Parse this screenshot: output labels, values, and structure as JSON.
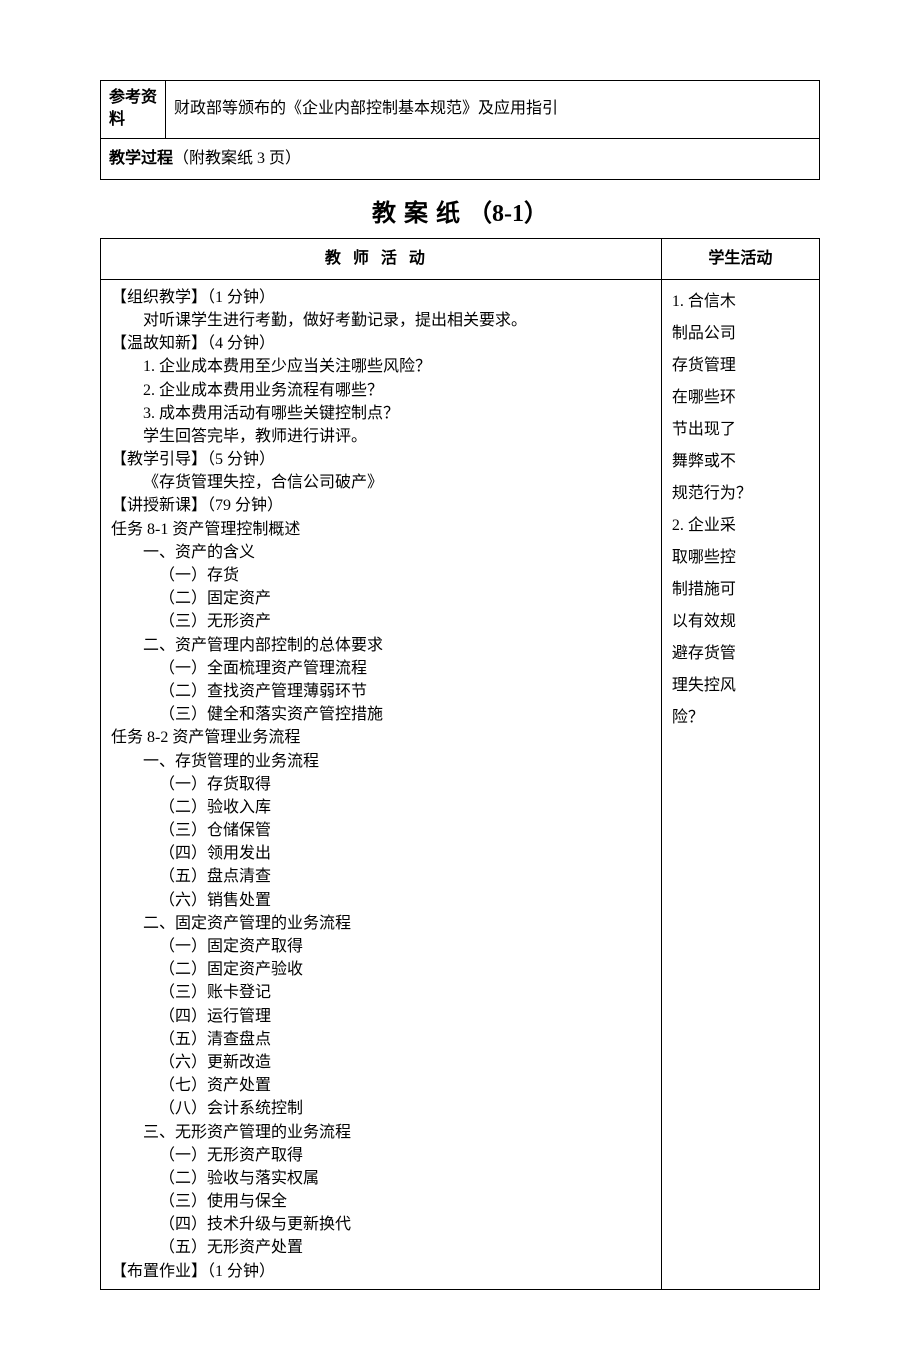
{
  "ref": {
    "label": "参考资料",
    "content": "财政部等颁布的《企业内部控制基本规范》及应用指引"
  },
  "process": {
    "label": "教学过程",
    "note": "（附教案纸 3 页）"
  },
  "title": {
    "main": "教案纸",
    "paren": "（8-1）"
  },
  "headers": {
    "teacher": "教师活动",
    "student": "学生活动"
  },
  "teacher_lines": [
    {
      "cls": "i1",
      "text": "【组织教学】（1 分钟）"
    },
    {
      "cls": "i2",
      "text": "对听课学生进行考勤，做好考勤记录，提出相关要求。"
    },
    {
      "cls": "i1",
      "text": "【温故知新】（4 分钟）"
    },
    {
      "cls": "i2",
      "text": "1. 企业成本费用至少应当关注哪些风险？"
    },
    {
      "cls": "i2",
      "text": "2. 企业成本费用业务流程有哪些？"
    },
    {
      "cls": "i2",
      "text": "3. 成本费用活动有哪些关键控制点？"
    },
    {
      "cls": "i2",
      "text": "学生回答完毕，教师进行讲评。"
    },
    {
      "cls": "i1",
      "text": "【教学引导】（5 分钟）"
    },
    {
      "cls": "i2",
      "text": "《存货管理失控，合信公司破产》"
    },
    {
      "cls": "i1",
      "text": "【讲授新课】（79 分钟）"
    },
    {
      "cls": "i1",
      "text": "任务 8-1  资产管理控制概述"
    },
    {
      "cls": "i2",
      "text": "一、资产的含义"
    },
    {
      "cls": "i3",
      "text": "（一）存货"
    },
    {
      "cls": "i3",
      "text": "（二）固定资产"
    },
    {
      "cls": "i3",
      "text": "（三）无形资产"
    },
    {
      "cls": "i2",
      "text": "二、资产管理内部控制的总体要求"
    },
    {
      "cls": "i3",
      "text": "（一）全面梳理资产管理流程"
    },
    {
      "cls": "i3",
      "text": "（二）查找资产管理薄弱环节"
    },
    {
      "cls": "i3",
      "text": "（三）健全和落实资产管控措施"
    },
    {
      "cls": "i1",
      "text": "任务 8-2  资产管理业务流程"
    },
    {
      "cls": "i2",
      "text": "一、存货管理的业务流程"
    },
    {
      "cls": "i3",
      "text": "（一）存货取得"
    },
    {
      "cls": "i3",
      "text": "（二）验收入库"
    },
    {
      "cls": "i3",
      "text": "（三）仓储保管"
    },
    {
      "cls": "i3",
      "text": "（四）领用发出"
    },
    {
      "cls": "i3",
      "text": "（五）盘点清查"
    },
    {
      "cls": "i3",
      "text": "（六）销售处置"
    },
    {
      "cls": "i2",
      "text": "二、固定资产管理的业务流程"
    },
    {
      "cls": "i3",
      "text": "（一）固定资产取得"
    },
    {
      "cls": "i3",
      "text": "（二）固定资产验收"
    },
    {
      "cls": "i3",
      "text": "（三）账卡登记"
    },
    {
      "cls": "i3",
      "text": "（四）运行管理"
    },
    {
      "cls": "i3",
      "text": "（五）清查盘点"
    },
    {
      "cls": "i3",
      "text": "（六）更新改造"
    },
    {
      "cls": "i3",
      "text": "（七）资产处置"
    },
    {
      "cls": "i3",
      "text": "（八）会计系统控制"
    },
    {
      "cls": "i2",
      "text": "三、无形资产管理的业务流程"
    },
    {
      "cls": "i3",
      "text": "（一）无形资产取得"
    },
    {
      "cls": "i3",
      "text": "（二）验收与落实权属"
    },
    {
      "cls": "i3",
      "text": "（三）使用与保全"
    },
    {
      "cls": "i3",
      "text": "（四）技术升级与更新换代"
    },
    {
      "cls": "i3",
      "text": "（五）无形资产处置"
    },
    {
      "cls": "i1",
      "text": "【布置作业】（1 分钟）"
    }
  ],
  "student_lines": [
    "1. 合信木",
    "制品公司",
    "存货管理",
    "在哪些环",
    "节出现了",
    "舞弊或不",
    "规范行为？",
    "2. 企业采",
    "取哪些控",
    "制措施可",
    "以有效规",
    "避存货管",
    "理失控风",
    "险？"
  ]
}
